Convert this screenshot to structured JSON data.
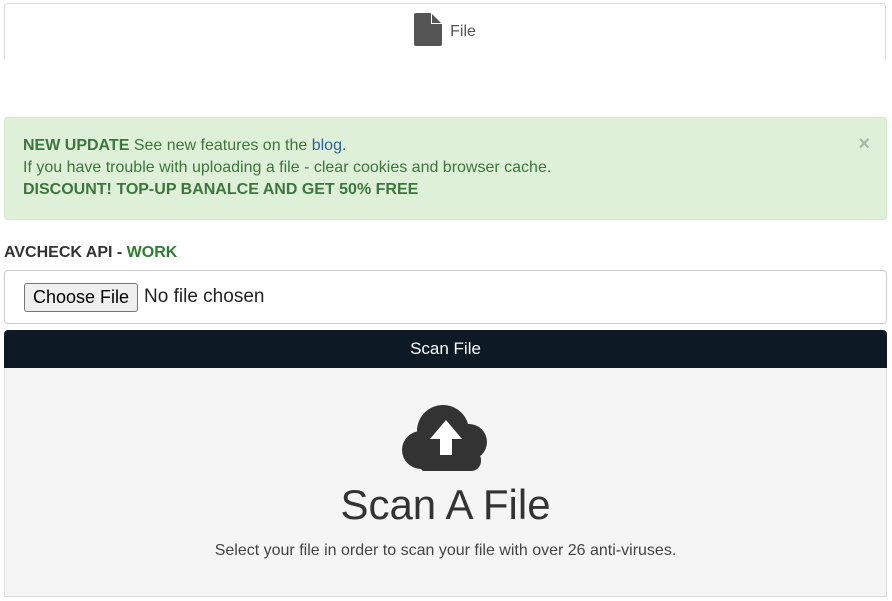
{
  "tab": {
    "label": "File",
    "icon": "file-icon"
  },
  "alert": {
    "headline": "NEW UPDATE",
    "line1_text": " See new features on the ",
    "line1_link": "blog",
    "line1_end": ".",
    "line2": "If you have trouble with uploading a file - clear cookies and browser cache.",
    "line3": "DISCOUNT! TOP-UP BANALCE AND GET 50% FREE",
    "close": "×"
  },
  "api_status": {
    "label": "AVCHECK API - ",
    "value": "WORK"
  },
  "file_input": {
    "button_label": "Choose File",
    "status": "No file chosen"
  },
  "scan_button": {
    "label": "Scan File"
  },
  "dropzone": {
    "icon": "cloud-upload-icon",
    "title": "Scan A File",
    "subtitle": "Select your file in order to scan your file with over 26 anti-viruses."
  },
  "colors": {
    "alert_bg": "#dff0d8",
    "alert_text": "#3c763d",
    "scan_button_bg": "#0d1a26",
    "work_green": "#2e7d32",
    "link_blue": "#2a6496"
  }
}
